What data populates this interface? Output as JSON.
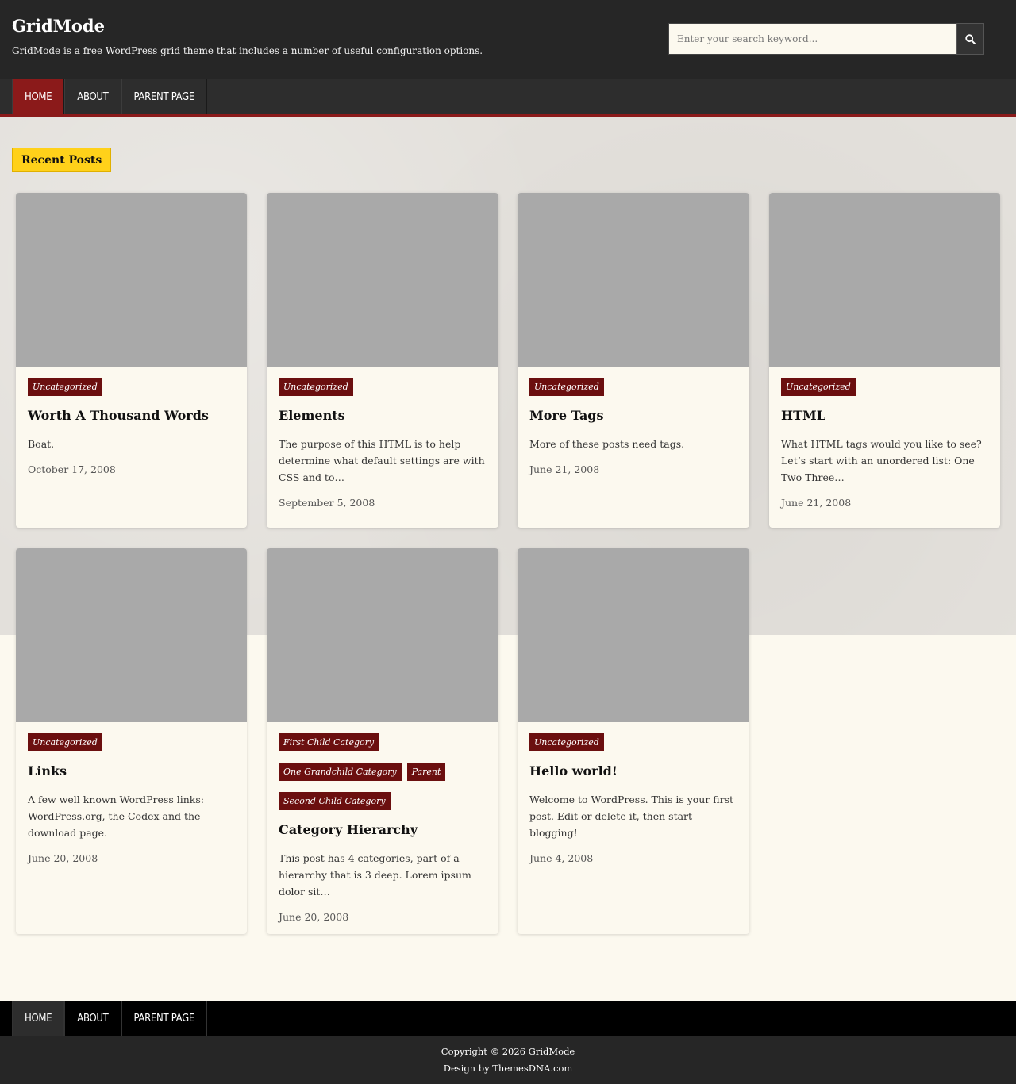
{
  "site": {
    "title": "GridMode",
    "description": "GridMode is a free WordPress grid theme that includes a number of useful configuration options."
  },
  "search": {
    "placeholder": "Enter your search keyword..."
  },
  "nav": {
    "items": [
      {
        "label": "HOME",
        "active": true
      },
      {
        "label": "ABOUT",
        "active": false
      },
      {
        "label": "PARENT PAGE",
        "active": false
      }
    ]
  },
  "section": {
    "label": "Recent Posts"
  },
  "posts": [
    {
      "categories": [
        "Uncategorized"
      ],
      "title": "Worth A Thousand Words",
      "excerpt": "Boat.",
      "date": "October 17, 2008"
    },
    {
      "categories": [
        "Uncategorized"
      ],
      "title": "Elements",
      "excerpt": "The purpose of this HTML is to help determine what default settings are with CSS and to…",
      "date": "September 5, 2008"
    },
    {
      "categories": [
        "Uncategorized"
      ],
      "title": "More Tags",
      "excerpt": "More of these posts need tags.",
      "date": "June 21, 2008"
    },
    {
      "categories": [
        "Uncategorized"
      ],
      "title": "HTML",
      "excerpt": "What HTML tags would you like to see? Let’s start with an unordered list: One Two Three…",
      "date": "June 21, 2008"
    },
    {
      "categories": [
        "Uncategorized"
      ],
      "title": "Links",
      "excerpt": "A few well known WordPress links: WordPress.org, the Codex and the download page.",
      "date": "June 20, 2008"
    },
    {
      "categories": [
        "First Child Category",
        "One Grandchild Category",
        "Parent",
        "Second Child Category"
      ],
      "title": "Category Hierarchy",
      "excerpt": "This post has 4 categories, part of a hierarchy that is 3 deep. Lorem ipsum dolor sit…",
      "date": "June 20, 2008"
    },
    {
      "categories": [
        "Uncategorized"
      ],
      "title": "Hello world!",
      "excerpt": "Welcome to WordPress. This is your first post. Edit or delete it, then start blogging!",
      "date": "June 4, 2008"
    }
  ],
  "footer_nav": {
    "items": [
      {
        "label": "HOME",
        "active": true
      },
      {
        "label": "ABOUT",
        "active": false
      },
      {
        "label": "PARENT PAGE",
        "active": false
      }
    ]
  },
  "footer": {
    "copyright": "Copyright © 2026 GridMode",
    "credit": "Design by ThemesDNA.com"
  },
  "colors": {
    "accent": "#8b1a1a",
    "category_bg": "#6b0f0f",
    "label_yellow": "#ffd11a",
    "thumbnail": "#a9a9a9"
  },
  "icons": {
    "search": "search-icon"
  }
}
